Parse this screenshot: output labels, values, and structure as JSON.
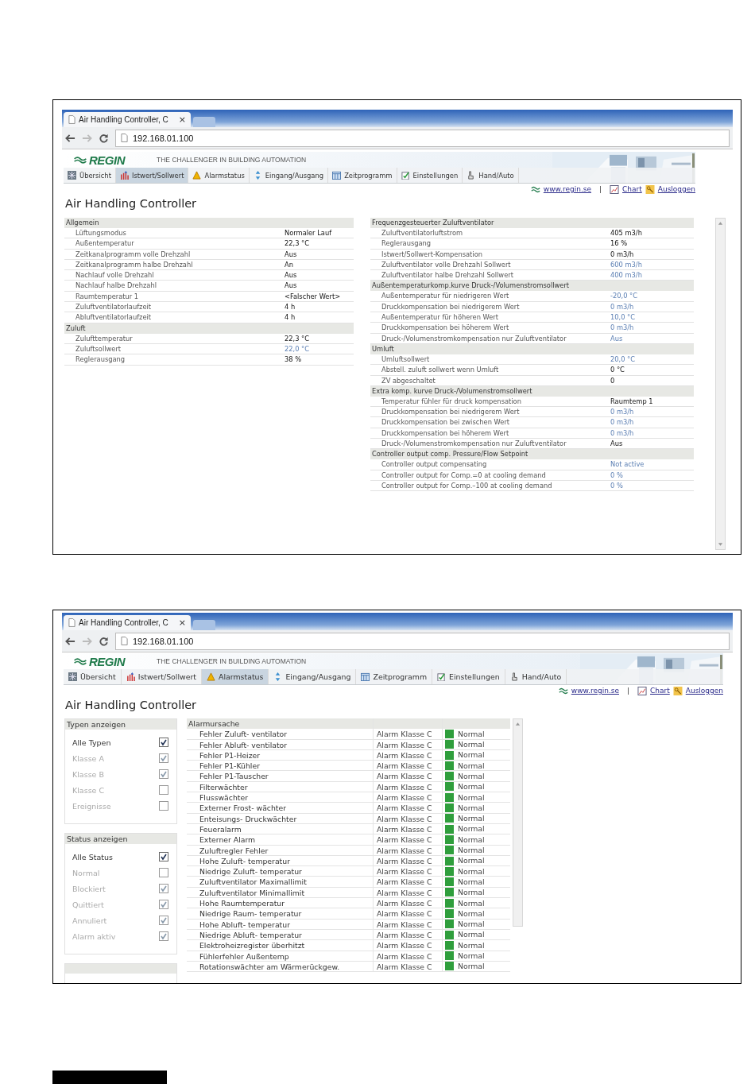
{
  "screenshots": [
    {
      "kind": "values",
      "browser": {
        "tab_title": "Air Handling Controller, C",
        "tab_close": "×",
        "url": "192.168.01.100"
      },
      "header": {
        "logo": "REGIN",
        "tagline": "THE CHALLENGER IN BUILDING AUTOMATION"
      },
      "nav_tabs": [
        {
          "label": "Übersicht",
          "selected": false
        },
        {
          "label": "Istwert/Sollwert",
          "selected": true
        },
        {
          "label": "Alarmstatus",
          "selected": false
        },
        {
          "label": "Eingang/Ausgang",
          "selected": false
        },
        {
          "label": "Zeitprogramm",
          "selected": false
        },
        {
          "label": "Einstellungen",
          "selected": false
        },
        {
          "label": "Hand/Auto",
          "selected": false
        }
      ],
      "links": {
        "website": "www.regin.se",
        "separator": "|",
        "chart": "Chart",
        "logout": "Ausloggen"
      },
      "title": "Air Handling Controller",
      "columns": [
        [
          {
            "title": "Allgemein",
            "rows": [
              {
                "label": "Lüftungsmodus",
                "value": "Normaler Lauf",
                "setpoint": false
              },
              {
                "label": "Außentemperatur",
                "value": "22,3 °C",
                "setpoint": false
              },
              {
                "label": "Zeitkanalprogramm volle Drehzahl",
                "value": "Aus",
                "setpoint": false
              },
              {
                "label": "Zeitkanalprogramm halbe Drehzahl",
                "value": "An",
                "setpoint": false
              },
              {
                "label": "Nachlauf volle Drehzahl",
                "value": "Aus",
                "setpoint": false
              },
              {
                "label": "Nachlauf halbe Drehzahl",
                "value": "Aus",
                "setpoint": false
              },
              {
                "label": "Raumtemperatur 1",
                "value": "<Falscher Wert>",
                "setpoint": false
              },
              {
                "label": "Zuluftventilatorlaufzeit",
                "value": "4 h",
                "setpoint": false
              },
              {
                "label": "Abluftventilatorlaufzeit",
                "value": "4 h",
                "setpoint": false
              }
            ]
          },
          {
            "title": "Zuluft",
            "rows": [
              {
                "label": "Zulufttemperatur",
                "value": "22,3 °C",
                "setpoint": false
              },
              {
                "label": "Zuluftsollwert",
                "value": "22,0 °C",
                "setpoint": true
              },
              {
                "label": "Reglerausgang",
                "value": "38 %",
                "setpoint": false
              }
            ]
          }
        ],
        [
          {
            "title": "Frequenzgesteuerter Zuluftventilator",
            "rows": [
              {
                "label": "Zuluftventilatorluftstrom",
                "value": "405 m3/h",
                "setpoint": false
              },
              {
                "label": "Reglerausgang",
                "value": "16 %",
                "setpoint": false
              },
              {
                "label": "Istwert/Sollwert-Kompensation",
                "value": "0 m3/h",
                "setpoint": false
              },
              {
                "label": "Zuluftventilator volle Drehzahl Sollwert",
                "value": "600 m3/h",
                "setpoint": true
              },
              {
                "label": "Zuluftventilator halbe Drehzahl Sollwert",
                "value": "400 m3/h",
                "setpoint": true
              }
            ]
          },
          {
            "title": "Außentemperaturkomp.kurve Druck-/Volumenstromsollwert",
            "rows": [
              {
                "label": "Außentemperatur für niedrigeren Wert",
                "value": "-20,0 °C",
                "setpoint": true
              },
              {
                "label": "Druckkompensation bei niedrigerem Wert",
                "value": "0 m3/h",
                "setpoint": true
              },
              {
                "label": "Außentemperatur für höheren Wert",
                "value": "10,0 °C",
                "setpoint": true
              },
              {
                "label": "Druckkompensation bei höherem Wert",
                "value": "0 m3/h",
                "setpoint": true
              },
              {
                "label": "Druck-/Volumenstromkompensation nur Zuluftventilator",
                "value": "Aus",
                "setpoint": true
              }
            ]
          },
          {
            "title": "Umluft",
            "rows": [
              {
                "label": "Umluftsollwert",
                "value": "20,0 °C",
                "setpoint": true
              },
              {
                "label": "Abstell. zuluft sollwert wenn Umluft",
                "value": "0 °C",
                "setpoint": false
              },
              {
                "label": "ZV abgeschaltet",
                "value": "0",
                "setpoint": false
              }
            ]
          },
          {
            "title": "Extra komp. kurve Druck-/Volumenstromsollwert",
            "rows": [
              {
                "label": "Temperatur fühler für druck kompensation",
                "value": "Raumtemp 1",
                "setpoint": false
              },
              {
                "label": "Druckkompensation bei niedrigerem Wert",
                "value": "0 m3/h",
                "setpoint": true
              },
              {
                "label": "Druckkompensation bei zwischen Wert",
                "value": "0 m3/h",
                "setpoint": true
              },
              {
                "label": "Druckkompensation bei höherem Wert",
                "value": "0 m3/h",
                "setpoint": true
              },
              {
                "label": "Druck-/Volumenstromkompensation nur Zuluftventilator",
                "value": "Aus",
                "setpoint": false
              }
            ]
          },
          {
            "title": "Controller output comp. Pressure/Flow Setpoint",
            "rows": [
              {
                "label": "Controller output compensating",
                "value": "Not active",
                "setpoint": true
              },
              {
                "label": "Controller output for Comp.=0 at cooling demand",
                "value": "0 %",
                "setpoint": true
              },
              {
                "label": "Controller output for Comp.–100 at cooling demand",
                "value": "0 %",
                "setpoint": true
              }
            ]
          }
        ]
      ]
    },
    {
      "kind": "alarms",
      "browser": {
        "tab_title": "Air Handling Controller, C",
        "tab_close": "×",
        "url": "192.168.01.100"
      },
      "header": {
        "logo": "REGIN",
        "tagline": "THE CHALLENGER IN BUILDING AUTOMATION"
      },
      "nav_tabs": [
        {
          "label": "Übersicht",
          "selected": false
        },
        {
          "label": "Istwert/Sollwert",
          "selected": false
        },
        {
          "label": "Alarmstatus",
          "selected": true
        },
        {
          "label": "Eingang/Ausgang",
          "selected": false
        },
        {
          "label": "Zeitprogramm",
          "selected": false
        },
        {
          "label": "Einstellungen",
          "selected": false
        },
        {
          "label": "Hand/Auto",
          "selected": false
        }
      ],
      "links": {
        "website": "www.regin.se",
        "separator": "|",
        "chart": "Chart",
        "logout": "Ausloggen"
      },
      "title": "Air Handling Controller",
      "filters": [
        {
          "title": "Typen anzeigen",
          "options": [
            {
              "label": "Alle Typen",
              "checked": true,
              "disabled": false
            },
            {
              "label": "Klasse A",
              "checked": true,
              "disabled": true
            },
            {
              "label": "Klasse B",
              "checked": true,
              "disabled": true
            },
            {
              "label": "Klasse C",
              "checked": false,
              "disabled": true
            },
            {
              "label": "Ereignisse",
              "checked": false,
              "disabled": true
            }
          ]
        },
        {
          "title": "Status anzeigen",
          "options": [
            {
              "label": "Alle Status",
              "checked": true,
              "disabled": false
            },
            {
              "label": "Normal",
              "checked": false,
              "disabled": true
            },
            {
              "label": "Blockiert",
              "checked": true,
              "disabled": true
            },
            {
              "label": "Quittiert",
              "checked": true,
              "disabled": true
            },
            {
              "label": "Annuliert",
              "checked": true,
              "disabled": true
            },
            {
              "label": "Alarm aktiv",
              "checked": true,
              "disabled": true
            }
          ]
        }
      ],
      "alarm_table": {
        "column_1": "Alarmursache",
        "rows": [
          {
            "cause": "Fehler Zuluft- ventilator",
            "class": "Alarm Klasse C",
            "status": "Normal",
            "color": "#2f9e3c"
          },
          {
            "cause": "Fehler Abluft- ventilator",
            "class": "Alarm Klasse C",
            "status": "Normal",
            "color": "#2f9e3c"
          },
          {
            "cause": "Fehler P1-Heizer",
            "class": "Alarm Klasse C",
            "status": "Normal",
            "color": "#2f9e3c"
          },
          {
            "cause": "Fehler P1-Kühler",
            "class": "Alarm Klasse C",
            "status": "Normal",
            "color": "#2f9e3c"
          },
          {
            "cause": "Fehler P1-Tauscher",
            "class": "Alarm Klasse C",
            "status": "Normal",
            "color": "#2f9e3c"
          },
          {
            "cause": "Filterwächter",
            "class": "Alarm Klasse C",
            "status": "Normal",
            "color": "#2f9e3c"
          },
          {
            "cause": "Flusswächter",
            "class": "Alarm Klasse C",
            "status": "Normal",
            "color": "#2f9e3c"
          },
          {
            "cause": "Externer Frost- wächter",
            "class": "Alarm Klasse C",
            "status": "Normal",
            "color": "#2f9e3c"
          },
          {
            "cause": "Enteisungs- Druckwächter",
            "class": "Alarm Klasse C",
            "status": "Normal",
            "color": "#2f9e3c"
          },
          {
            "cause": "Feueralarm",
            "class": "Alarm Klasse C",
            "status": "Normal",
            "color": "#2f9e3c"
          },
          {
            "cause": "Externer Alarm",
            "class": "Alarm Klasse C",
            "status": "Normal",
            "color": "#2f9e3c"
          },
          {
            "cause": "Zuluftregler Fehler",
            "class": "Alarm Klasse C",
            "status": "Normal",
            "color": "#2f9e3c"
          },
          {
            "cause": "Hohe Zuluft- temperatur",
            "class": "Alarm Klasse C",
            "status": "Normal",
            "color": "#2f9e3c"
          },
          {
            "cause": "Niedrige Zuluft- temperatur",
            "class": "Alarm Klasse C",
            "status": "Normal",
            "color": "#2f9e3c"
          },
          {
            "cause": "Zuluftventilator Maximallimit",
            "class": "Alarm Klasse C",
            "status": "Normal",
            "color": "#2f9e3c"
          },
          {
            "cause": "Zuluftventilator Minimallimit",
            "class": "Alarm Klasse C",
            "status": "Normal",
            "color": "#2f9e3c"
          },
          {
            "cause": "Hohe Raumtemperatur",
            "class": "Alarm Klasse C",
            "status": "Normal",
            "color": "#2f9e3c"
          },
          {
            "cause": "Niedrige Raum- temperatur",
            "class": "Alarm Klasse C",
            "status": "Normal",
            "color": "#2f9e3c"
          },
          {
            "cause": "Hohe Abluft- temperatur",
            "class": "Alarm Klasse C",
            "status": "Normal",
            "color": "#2f9e3c"
          },
          {
            "cause": "Niedrige Abluft- temperatur",
            "class": "Alarm Klasse C",
            "status": "Normal",
            "color": "#2f9e3c"
          },
          {
            "cause": "Elektroheizregister überhitzt",
            "class": "Alarm Klasse C",
            "status": "Normal",
            "color": "#2f9e3c"
          },
          {
            "cause": "Fühlerfehler Außentemp",
            "class": "Alarm Klasse C",
            "status": "Normal",
            "color": "#2f9e3c"
          },
          {
            "cause": "Rotationswächter am Wärmerückgew.",
            "class": "Alarm Klasse C",
            "status": "Normal",
            "color": "#2f9e3c"
          }
        ]
      }
    }
  ]
}
